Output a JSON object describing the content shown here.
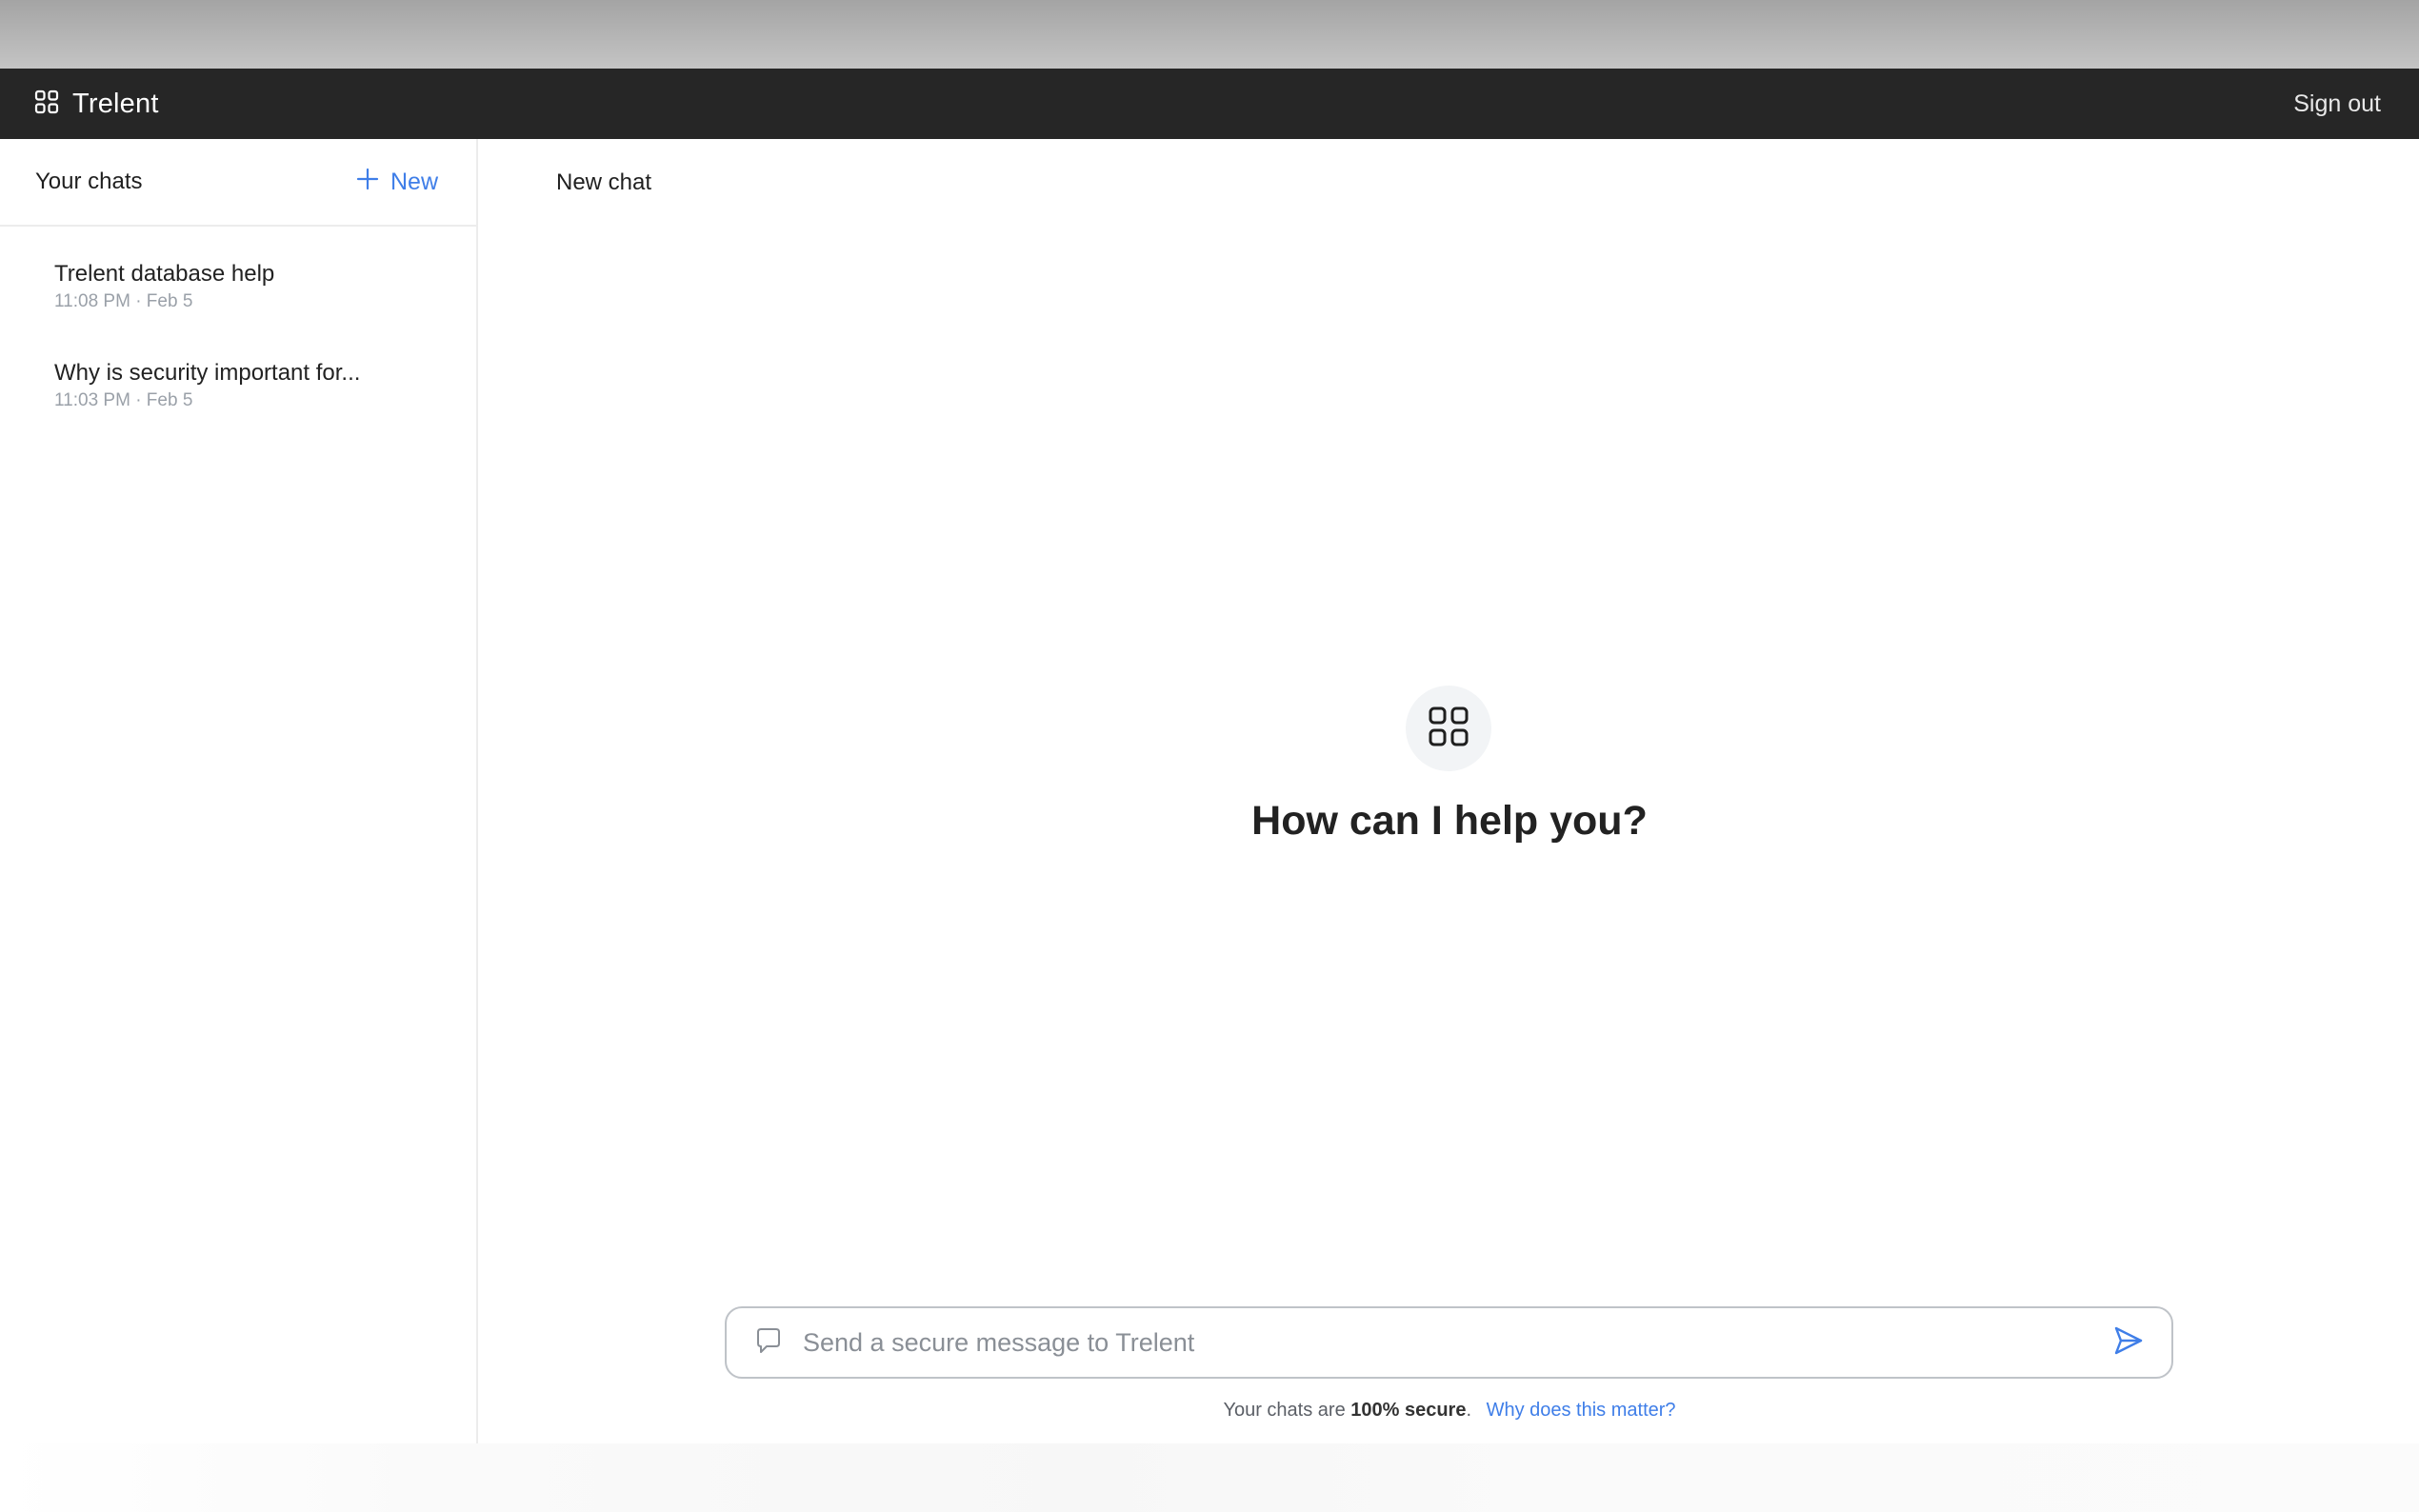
{
  "app": {
    "name": "Trelent",
    "sign_out_label": "Sign out"
  },
  "sidebar": {
    "title": "Your chats",
    "new_label": "New",
    "chats": [
      {
        "title": "Trelent database help",
        "meta": "11:08 PM · Feb 5"
      },
      {
        "title": "Why is security important for...",
        "meta": "11:03 PM · Feb 5"
      }
    ]
  },
  "main": {
    "title": "New chat",
    "heading": "How can I help you?",
    "composer": {
      "placeholder": "Send a secure message to Trelent"
    },
    "footnote": {
      "prefix": "Your chats are ",
      "bold": "100% secure",
      "suffix": ".",
      "link": "Why does this matter?"
    }
  },
  "colors": {
    "topbar": "#262626",
    "accent": "#3f7ee8"
  }
}
